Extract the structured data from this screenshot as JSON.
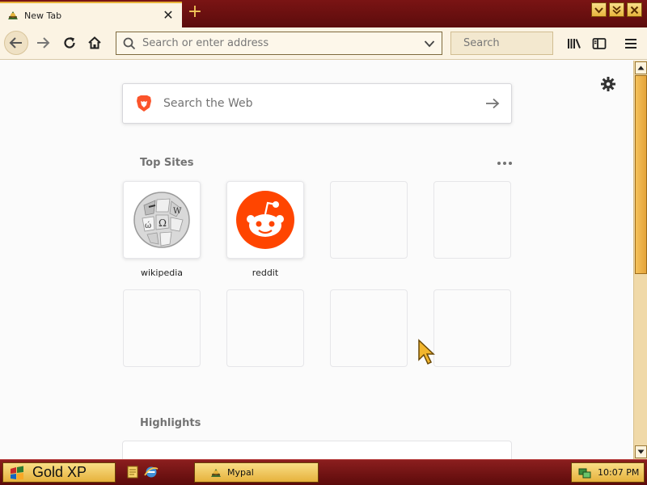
{
  "tab": {
    "title": "New Tab",
    "close": "✕",
    "new_tab": "+"
  },
  "toolbar": {
    "address_placeholder": "Search or enter address",
    "search_placeholder": "Search"
  },
  "newtab": {
    "web_search_placeholder": "Search the Web",
    "top_sites_title": "Top Sites",
    "highlights_title": "Highlights",
    "sites": [
      {
        "label": "wikipedia",
        "icon": "wikipedia-icon"
      },
      {
        "label": "reddit",
        "icon": "reddit-icon"
      }
    ]
  },
  "taskbar": {
    "start_label": "Gold XP",
    "window_label": "Mypal",
    "clock": "10:07 PM"
  },
  "colors": {
    "chrome_dark": "#5c0c0c",
    "chrome_light": "#fbf3e3",
    "gold": "#e6b23c",
    "reddit_orange": "#ff4500"
  }
}
